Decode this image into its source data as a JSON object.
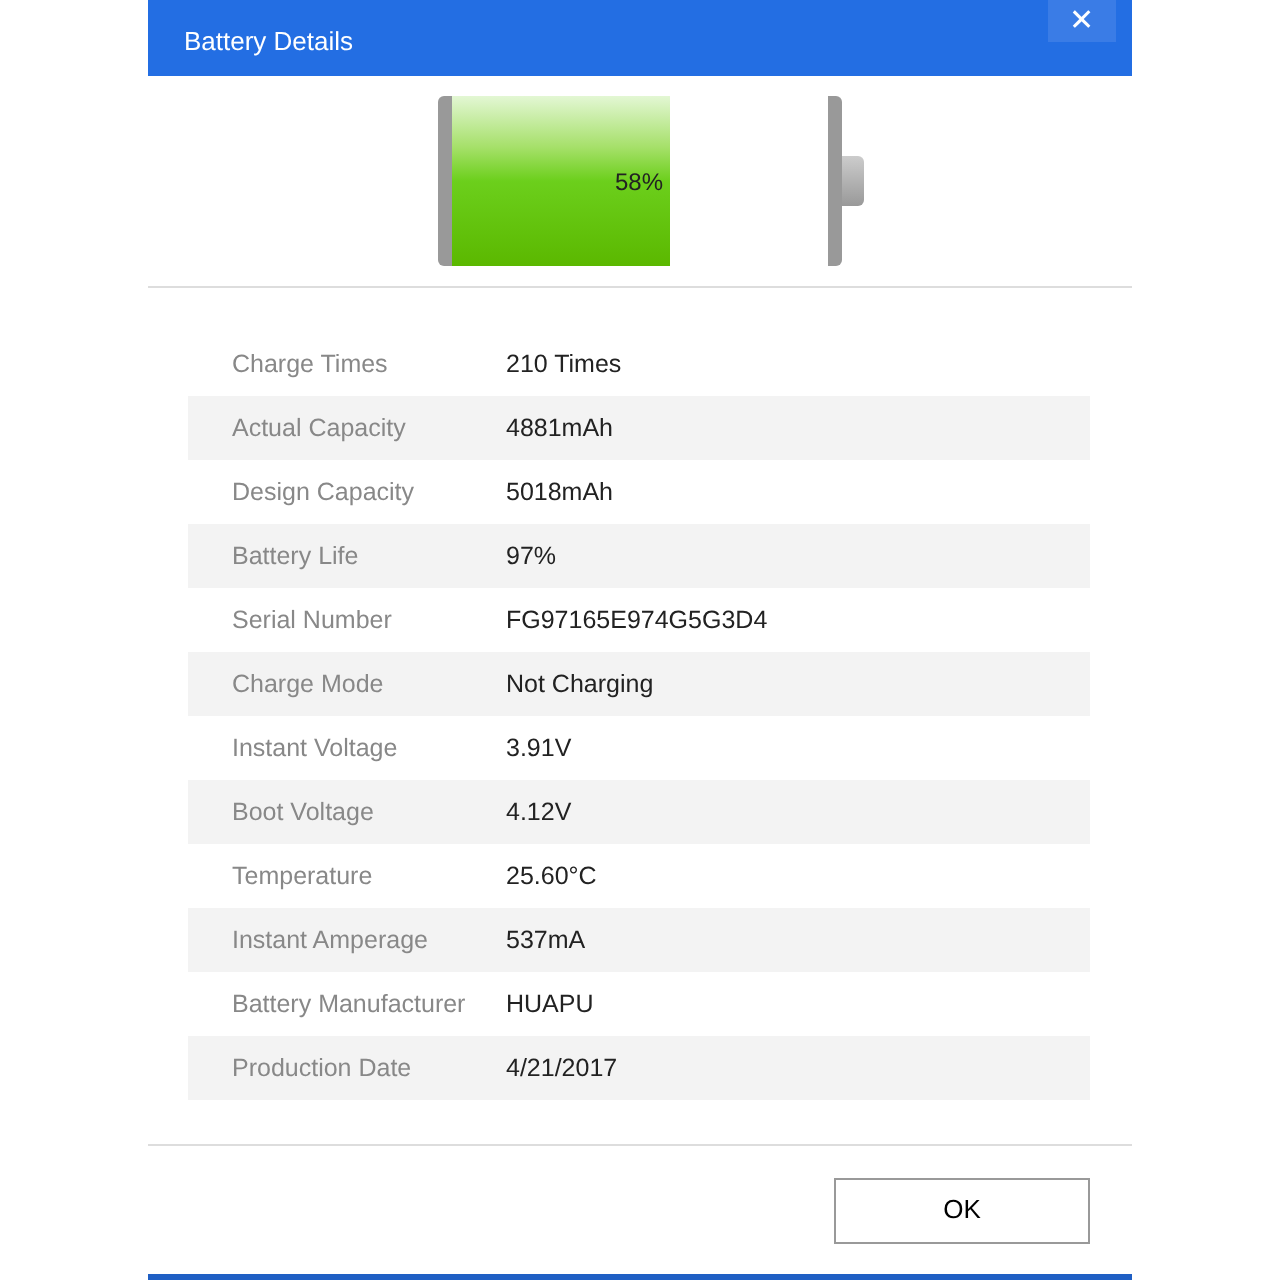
{
  "window": {
    "title": "Battery Details",
    "close": "✕"
  },
  "battery": {
    "level": 0.58,
    "reading": "58%"
  },
  "details": [
    {
      "label": "Charge Times",
      "value": "210 Times"
    },
    {
      "label": "Actual Capacity",
      "value": "4881mAh"
    },
    {
      "label": "Design Capacity",
      "value": "5018mAh"
    },
    {
      "label": "Battery Life",
      "value": "97%"
    },
    {
      "label": "Serial Number",
      "value": "FG97165E974G5G3D4"
    },
    {
      "label": "Charge Mode",
      "value": "Not Charging"
    },
    {
      "label": "Instant Voltage",
      "value": "3.91V"
    },
    {
      "label": "Boot Voltage",
      "value": "4.12V"
    },
    {
      "label": "Temperature",
      "value": "25.60°C"
    },
    {
      "label": "Instant Amperage",
      "value": "537mA"
    },
    {
      "label": "Battery Manufacturer",
      "value": "HUAPU"
    },
    {
      "label": "Production Date",
      "value": "4/21/2017"
    }
  ],
  "buttons": [
    "OK"
  ]
}
